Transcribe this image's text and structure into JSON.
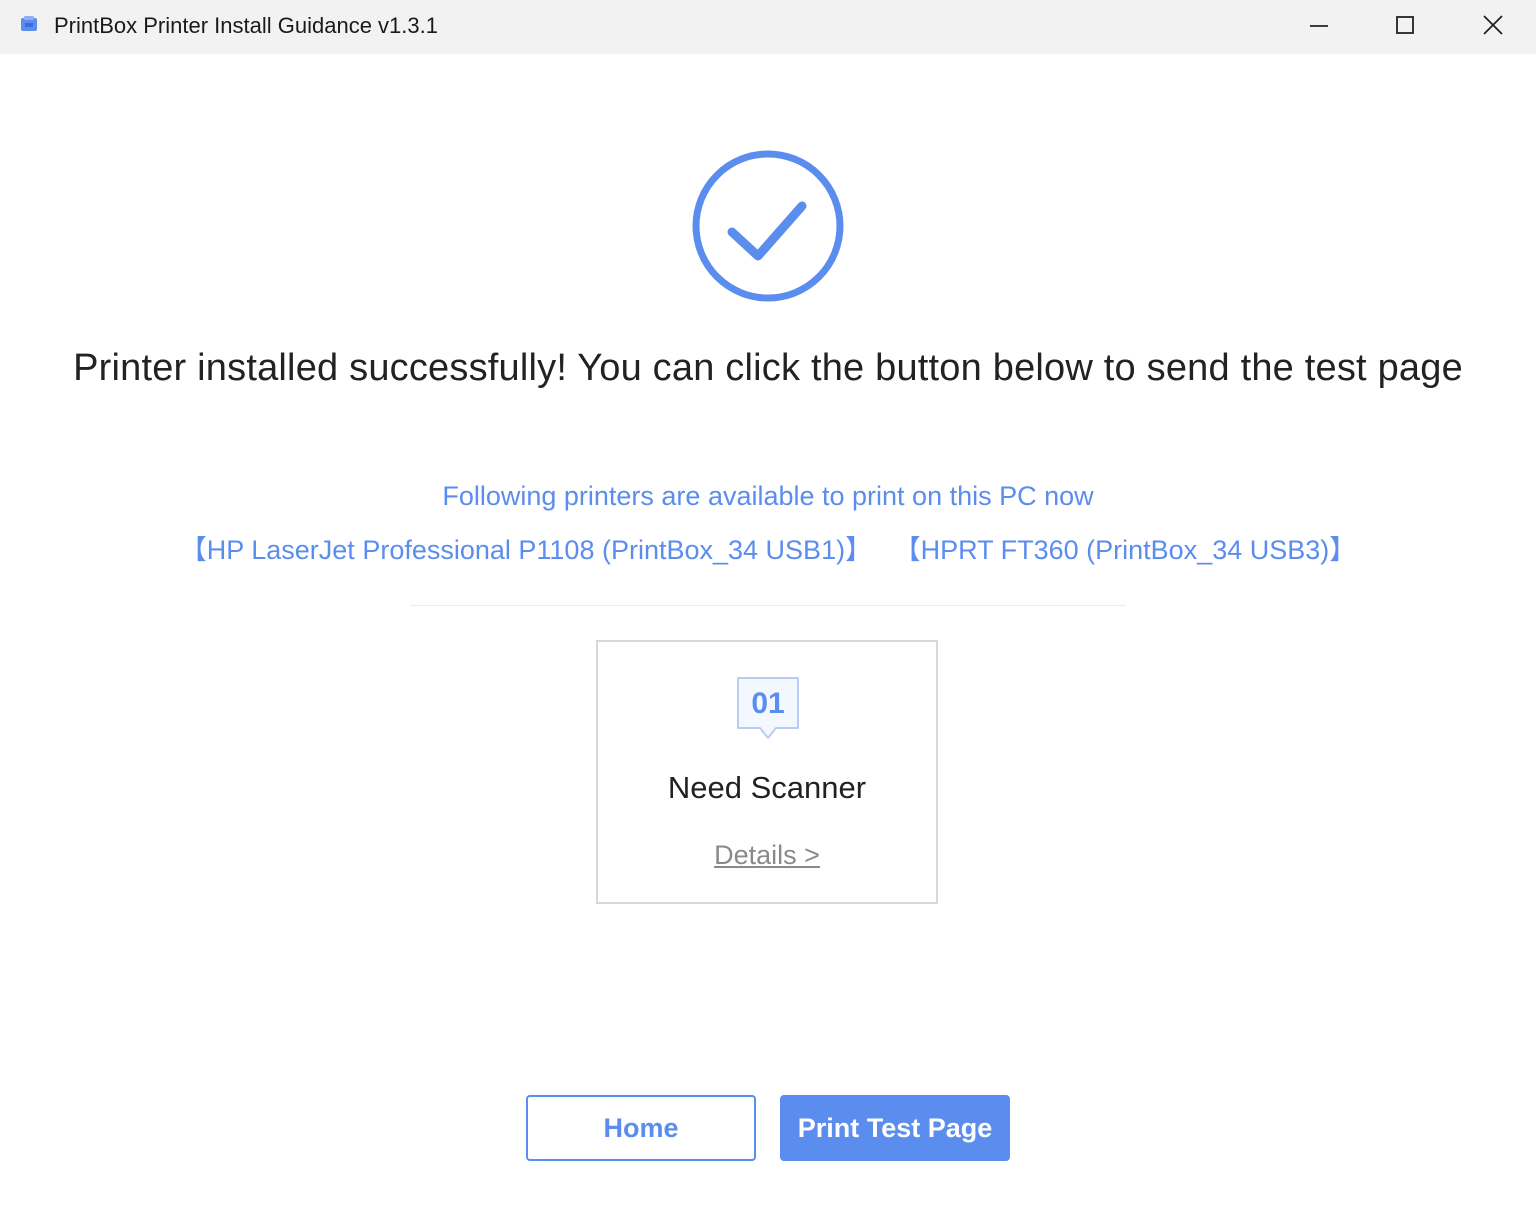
{
  "window": {
    "title": "PrintBox Printer Install Guidance v1.3.1",
    "controls": {
      "minimize": "minimize-icon",
      "maximize": "maximize-icon",
      "close": "close-icon"
    }
  },
  "status": {
    "icon": "checkmark-circle-icon",
    "headline": "Printer installed successfully! You can click the button below to send the test page",
    "available_text": "Following printers are available to print on this PC now",
    "printers": [
      "【HP LaserJet Professional P1108 (PrintBox_34 USB1)】",
      "【HPRT FT360 (PrintBox_34 USB3)】"
    ]
  },
  "card": {
    "number": "01",
    "title": "Need Scanner",
    "link": "Details >"
  },
  "buttons": {
    "home": "Home",
    "print_test_page": "Print Test Page"
  },
  "colors": {
    "accent": "#5b8def",
    "text": "#222222",
    "muted": "#8a8a8a",
    "titlebar": "#f2f2f2"
  }
}
